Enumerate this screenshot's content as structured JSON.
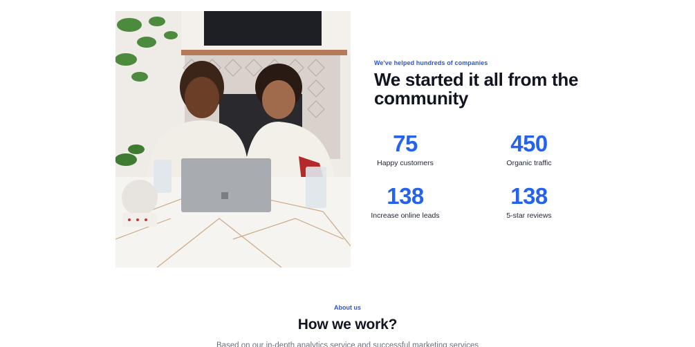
{
  "hero": {
    "eyebrow": "We've helped hundreds of companies",
    "title": "We started it all from the community",
    "photo_alt": "two-people-laptop-photo"
  },
  "stats": [
    {
      "value": "75",
      "label": "Happy customers"
    },
    {
      "value": "450",
      "label": "Organic traffic"
    },
    {
      "value": "138",
      "label": "Increase online leads"
    },
    {
      "value": "138",
      "label": "5-star reviews"
    }
  ],
  "about": {
    "eyebrow": "About us",
    "heading": "How we work?",
    "description": "Based on our in-depth analytics service and successful marketing services"
  },
  "colors": {
    "accent": "#2563eb",
    "heading": "#111421"
  }
}
